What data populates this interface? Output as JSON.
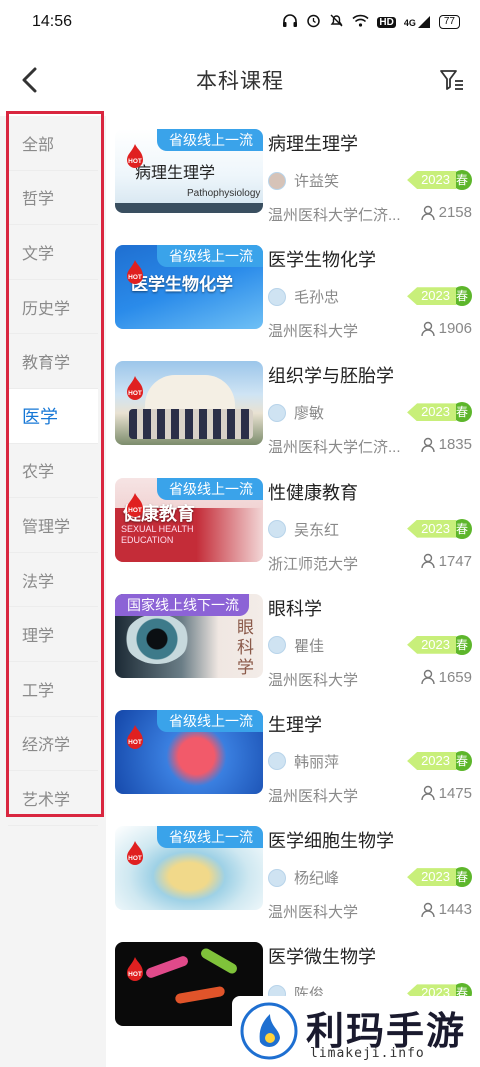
{
  "status_bar": {
    "time": "14:56",
    "hd_label": "HD",
    "network_label": "4G",
    "battery": "77"
  },
  "header": {
    "title": "本科课程",
    "back_icon": "chevron-left-icon",
    "filter_icon": "filter-icon"
  },
  "sidebar": {
    "active_index": 5,
    "items": [
      {
        "label": "全部"
      },
      {
        "label": "哲学"
      },
      {
        "label": "文学"
      },
      {
        "label": "历史学"
      },
      {
        "label": "教育学"
      },
      {
        "label": "医学"
      },
      {
        "label": "农学"
      },
      {
        "label": "管理学"
      },
      {
        "label": "法学"
      },
      {
        "label": "理学"
      },
      {
        "label": "工学"
      },
      {
        "label": "经济学"
      },
      {
        "label": "艺术学"
      }
    ]
  },
  "courses": [
    {
      "title": "病理生理学",
      "badge": "省级线上一流",
      "hot": "HOT",
      "thumb_caption": "病理生理学",
      "thumb_sub": "Pathophysiology",
      "teacher": "许益笑",
      "year": "2023",
      "season": "春",
      "school": "温州医科大学仁济...",
      "learners": "2158"
    },
    {
      "title": "医学生物化学",
      "badge": "省级线上一流",
      "hot": "HOT",
      "thumb_caption": "医学生物化学",
      "thumb_sub": "",
      "teacher": "毛孙忠",
      "year": "2023",
      "season": "春",
      "school": "温州医科大学",
      "learners": "1906"
    },
    {
      "title": "组织学与胚胎学",
      "badge": "",
      "hot": "HOT",
      "thumb_caption": "",
      "thumb_sub": "",
      "teacher": "廖敏",
      "year": "2023",
      "season": "春",
      "school": "温州医科大学仁济...",
      "learners": "1835"
    },
    {
      "title": "性健康教育",
      "badge": "省级线上一流",
      "hot": "HOT",
      "thumb_caption": "健康教育",
      "thumb_sub": "SEXUAL HEALTH EDUCATION",
      "teacher": "吴东红",
      "year": "2023",
      "season": "春",
      "school": "浙江师范大学",
      "learners": "1747"
    },
    {
      "title": "眼科学",
      "badge": "国家线上线下一流",
      "hot": "",
      "thumb_caption": "眼科学",
      "thumb_sub": "",
      "teacher": "瞿佳",
      "year": "2023",
      "season": "春",
      "school": "温州医科大学",
      "learners": "1659"
    },
    {
      "title": "生理学",
      "badge": "省级线上一流",
      "hot": "HOT",
      "thumb_caption": "",
      "thumb_sub": "",
      "teacher": "韩丽萍",
      "year": "2023",
      "season": "春",
      "school": "温州医科大学",
      "learners": "1475"
    },
    {
      "title": "医学细胞生物学",
      "badge": "省级线上一流",
      "hot": "HOT",
      "thumb_caption": "",
      "thumb_sub": "",
      "teacher": "杨纪峰",
      "year": "2023",
      "season": "春",
      "school": "温州医科大学",
      "learners": "1443"
    },
    {
      "title": "医学微生物学",
      "badge": "",
      "hot": "HOT",
      "thumb_caption": "",
      "thumb_sub": "",
      "teacher": "陈俊",
      "year": "2023",
      "season": "春",
      "school": "",
      "learners": ""
    }
  ],
  "watermark": {
    "title": "利玛手游",
    "url": "limakeji.info"
  },
  "colors": {
    "accent": "#1677d6",
    "highlight_frame": "#d9263f",
    "badge_blue": "#3aa3ea",
    "badge_purple": "#8c63d6",
    "year_green": "#c8ef7a",
    "season_green": "#5db62b"
  }
}
